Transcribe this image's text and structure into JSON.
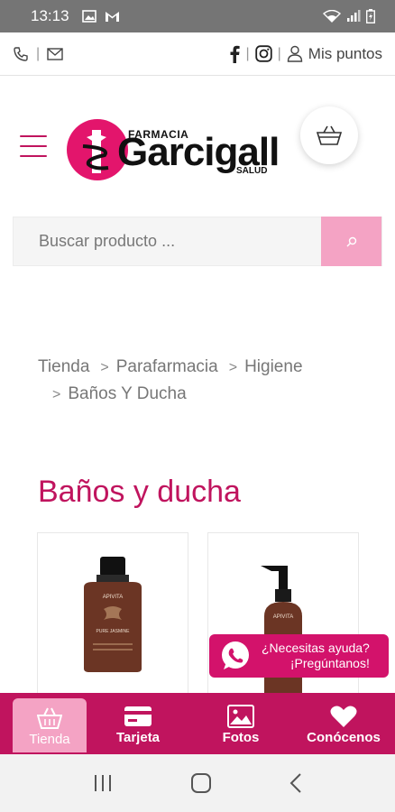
{
  "status_bar": {
    "time": "13:13"
  },
  "top_bar": {
    "phone_icon": "phone-icon",
    "mail_icon": "mail-icon",
    "facebook_icon": "facebook-icon",
    "instagram_icon": "instagram-icon",
    "points_label": "Mis puntos"
  },
  "header": {
    "logo": {
      "top": "FARMACIA",
      "name": "Garcigall",
      "bottom": "SALUD"
    }
  },
  "search": {
    "placeholder": "Buscar producto ..."
  },
  "breadcrumb": {
    "items": [
      "Tienda",
      "Parafarmacia",
      "Higiene",
      "Baños Y Ducha"
    ]
  },
  "page_title": "Baños y ducha",
  "products": [
    {
      "brand": "APIVITA",
      "name": "PURE JASMINE"
    },
    {
      "brand": "APIVITA",
      "name": ""
    }
  ],
  "whatsapp": {
    "line1": "¿Necesitas ayuda?",
    "line2": "¡Pregúntanos!"
  },
  "bottom_nav": {
    "items": [
      {
        "label": "Tienda",
        "icon": "basket-icon",
        "active": true
      },
      {
        "label": "Tarjeta",
        "icon": "card-icon",
        "active": false
      },
      {
        "label": "Fotos",
        "icon": "image-icon",
        "active": false
      },
      {
        "label": "Conócenos",
        "icon": "heart-icon",
        "active": false
      }
    ]
  },
  "colors": {
    "brand": "#c0145e",
    "brand_light": "#f4a3c4",
    "whatsapp_bg": "#d3126b"
  }
}
